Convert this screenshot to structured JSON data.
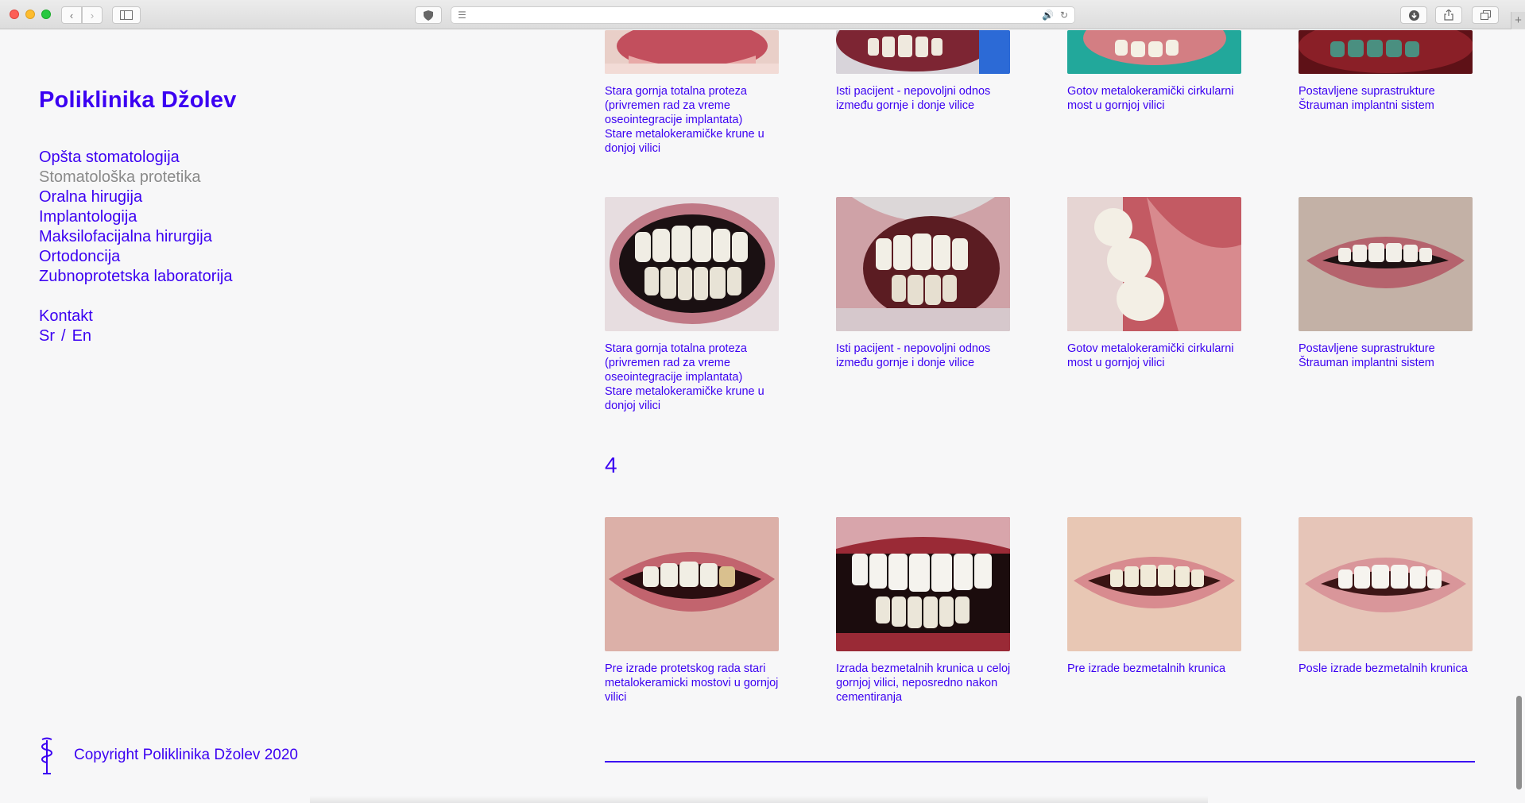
{
  "browser": {
    "controls": [
      "close-light",
      "minimize-light",
      "zoom-light"
    ],
    "accent": "#3b00f2"
  },
  "site": {
    "title": "Poliklinika Džolev",
    "copyright": "Copyright Poliklinika Džolev 2020"
  },
  "nav": {
    "items": [
      {
        "label": "Opšta stomatologija"
      },
      {
        "label": "Stomatološka protetika"
      },
      {
        "label": "Oralna hirugija"
      },
      {
        "label": "Implantologija"
      },
      {
        "label": "Maksilofacijalna hirurgija"
      },
      {
        "label": "Ortodoncija"
      },
      {
        "label": "Zubnoprotetska laboratorija"
      }
    ],
    "contact": "Kontakt",
    "lang_sr": "Sr",
    "lang_sep": "/",
    "lang_en": "En"
  },
  "gallery": {
    "top_row": [
      {
        "caption": "Stara gornja totalna proteza (privremen rad za vreme oseointegracije implantata)\nStare metalokeramičke krune u donjoj vilici"
      },
      {
        "caption": "Isti pacijent - nepovoljni odnos između gornje i donje vilice"
      },
      {
        "caption": "Gotov metalokeramički cirkularni most u gornjoj vilici"
      },
      {
        "caption": "Postavljene suprastrukture Štrauman implantni sistem"
      }
    ],
    "middle_row": [
      {
        "caption": "Stara gornja totalna proteza (privremen rad za vreme oseointegracije implantata)\nStare metalokeramičke krune u donjoj vilici"
      },
      {
        "caption": "Isti pacijent - nepovoljni odnos između gornje i donje vilice"
      },
      {
        "caption": "Gotov metalokeramički cirkularni most u gornjoj vilici"
      },
      {
        "caption": "Postavljene suprastrukture Štrauman implantni sistem"
      }
    ],
    "section_number": "4",
    "bottom_row": [
      {
        "caption": "Pre izrade protetskog rada stari metalokeramicki mostovi u gornjoj vilici"
      },
      {
        "caption": "Izrada bezmetalnih krunica u celoj gornjoj vilici, neposredno nakon cementiranja"
      },
      {
        "caption": "Pre izrade bezmetalnih krunica"
      },
      {
        "caption": "Posle izrade bezmetalnih krunica"
      }
    ]
  }
}
